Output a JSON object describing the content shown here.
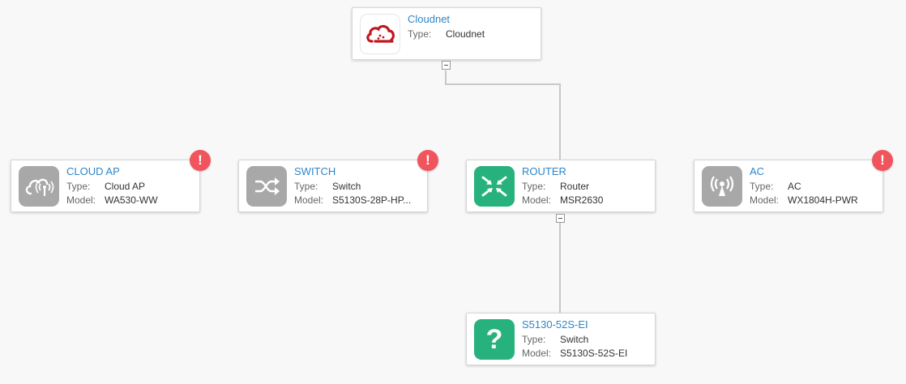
{
  "nodes": {
    "cloudnet": {
      "title": "Cloudnet",
      "type_label": "Type:",
      "type": "Cloudnet",
      "icon": "cloud-icon"
    },
    "cloud_ap": {
      "title": "CLOUD AP",
      "type_label": "Type:",
      "type": "Cloud AP",
      "model_label": "Model:",
      "model": "WA530-WW",
      "icon": "cloud-ap-icon",
      "alert": "!"
    },
    "switch": {
      "title": "SWITCH",
      "type_label": "Type:",
      "type": "Switch",
      "model_label": "Model:",
      "model": "S5130S-28P-HP...",
      "icon": "shuffle-icon",
      "alert": "!"
    },
    "router": {
      "title": "ROUTER",
      "type_label": "Type:",
      "type": "Router",
      "model_label": "Model:",
      "model": "MSR2630",
      "icon": "router-arrows-icon"
    },
    "ac": {
      "title": "AC",
      "type_label": "Type:",
      "type": "AC",
      "model_label": "Model:",
      "model": "WX1804H-PWR",
      "icon": "wireless-antenna-icon",
      "alert": "!"
    },
    "s5130": {
      "title": "S5130-52S-EI",
      "type_label": "Type:",
      "type": "Switch",
      "model_label": "Model:",
      "model": "S5130S-52S-EI",
      "icon": "question-mark-icon",
      "icon_glyph": "?"
    }
  },
  "colors": {
    "title": "#2f86c8",
    "icon_gray": "#a8a8a8",
    "icon_green": "#27b27d",
    "alert": "#f0555d",
    "cloud_red": "#c0161e"
  }
}
